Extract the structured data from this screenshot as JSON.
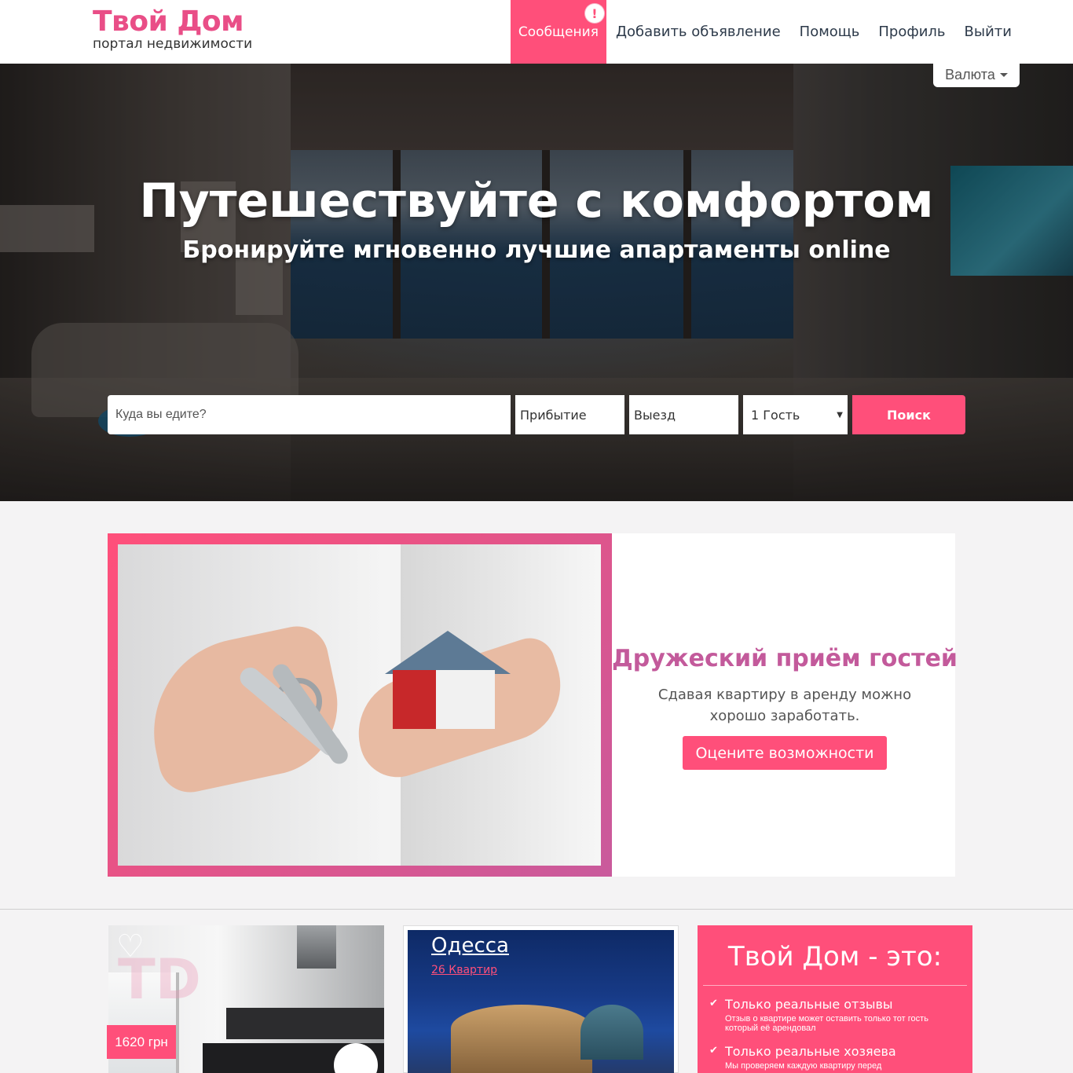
{
  "header": {
    "logo_title": "Твой Дом",
    "logo_subtitle": "портал недвижимости",
    "nav": [
      {
        "label": "Сообщения",
        "active": true,
        "alert": "!"
      },
      {
        "label": "Добавить объявление"
      },
      {
        "label": "Помощь"
      },
      {
        "label": "Профиль"
      },
      {
        "label": "Выйти"
      }
    ],
    "currency_label": "Валюта"
  },
  "hero": {
    "title": "Путешествуйте с комфортом",
    "subtitle": "Бронируйте мгновенно лучшие апартаменты online"
  },
  "search": {
    "where_placeholder": "Куда вы едите?",
    "arrive_label": "Прибытие",
    "leave_label": "Выезд",
    "guests_value": "1 Гость",
    "button_label": "Поиск"
  },
  "promo": {
    "title": "Дружеский приём гостей",
    "description": "Сдавая квартиру в аренду можно хорошо заработать.",
    "button_label": "Оцените возможности"
  },
  "cards": {
    "listing": {
      "watermark": "TD",
      "price": "1620 грн"
    },
    "city": {
      "name": "Одесса",
      "count": "26 Квартир"
    },
    "about": {
      "title": "Твой Дом - это:",
      "features": [
        {
          "title": "Только реальные отзывы",
          "desc": "Отзыв о квартире может оставить только тот гость который её арендовал"
        },
        {
          "title": "Только реальные хозяева",
          "desc": "Мы проверяем каждую квартиру перед"
        }
      ]
    }
  },
  "colors": {
    "accent": "#ff4f7a",
    "logo": "#e94e87",
    "promo_title": "#c35a9b"
  },
  "icons": [
    "alert-icon",
    "caret-down-icon",
    "select-arrow-icon",
    "heart-icon",
    "check-icon"
  ]
}
